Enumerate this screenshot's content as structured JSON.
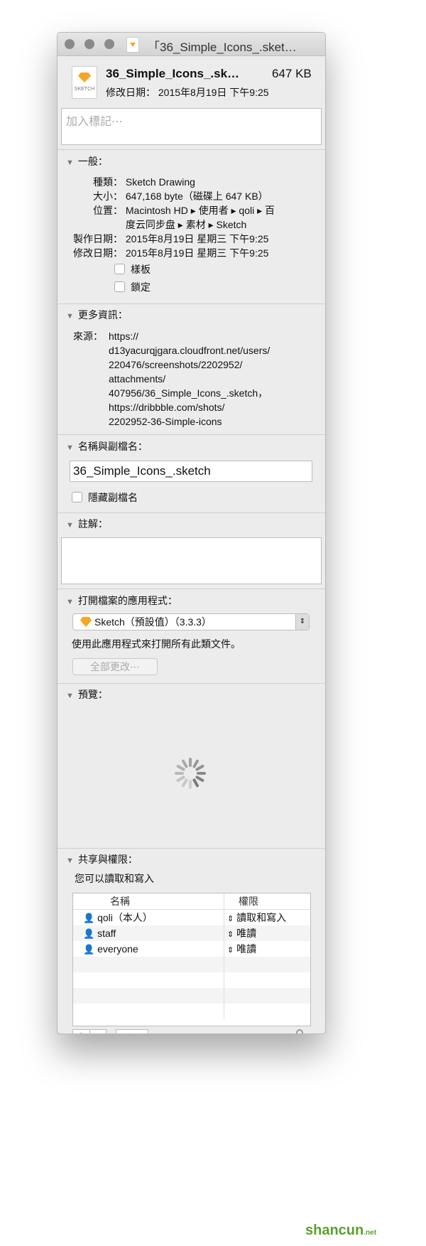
{
  "window": {
    "title": "「36_Simple_Icons_.sket…"
  },
  "header": {
    "filename": "36_Simple_Icons_.sk…",
    "size": "647 KB",
    "modified": "修改日期： 2015年8月19日 下午9:25",
    "icon_label": "SKETCH"
  },
  "tags": {
    "placeholder": "加入標記⋯"
  },
  "general": {
    "title": "一般：",
    "rows": [
      {
        "label": "種類：",
        "value": "Sketch Drawing"
      },
      {
        "label": "大小：",
        "value": "647,168 byte（磁碟上 647 KB）"
      },
      {
        "label": "位置：",
        "value": "Macintosh HD ▸ 使用者 ▸ qoli ▸ 百"
      },
      {
        "label": "",
        "value": "度云同步盘 ▸ 素材 ▸ Sketch"
      },
      {
        "label": "製作日期：",
        "value": "2015年8月19日 星期三 下午9:25"
      },
      {
        "label": "修改日期：",
        "value": "2015年8月19日 星期三 下午9:25"
      }
    ],
    "stationery": "樣板",
    "locked": "鎖定"
  },
  "more_info": {
    "title": "更多資訊：",
    "label": "來源：",
    "lines": [
      "https://",
      "d13yacurqjgara.cloudfront.net/users/",
      "220476/screenshots/2202952/",
      "attachments/",
      "407956/36_Simple_Icons_.sketch，",
      "https://dribbble.com/shots/",
      "2202952-36-Simple-icons"
    ]
  },
  "name_ext": {
    "title": "名稱與副檔名：",
    "value": "36_Simple_Icons_.sketch",
    "hide_ext": "隱藏副檔名"
  },
  "comments": {
    "title": "註解："
  },
  "open_with": {
    "title": "打開檔案的應用程式：",
    "app": "Sketch（預設值）（3.3.3）",
    "note": "使用此應用程式來打開所有此類文件。",
    "change_all": "全部更改⋯"
  },
  "preview": {
    "title": "預覽："
  },
  "sharing": {
    "title": "共享與權限：",
    "status": "您可以讀取和寫入",
    "col_name": "名稱",
    "col_priv": "權限",
    "rows": [
      {
        "name": "qoli（本人）",
        "priv": "讀取和寫入"
      },
      {
        "name": "staff",
        "priv": "唯讀"
      },
      {
        "name": "everyone",
        "priv": "唯讀"
      }
    ]
  },
  "colors": {
    "lock": "#e8a33a",
    "sketch": "#f5a623"
  }
}
